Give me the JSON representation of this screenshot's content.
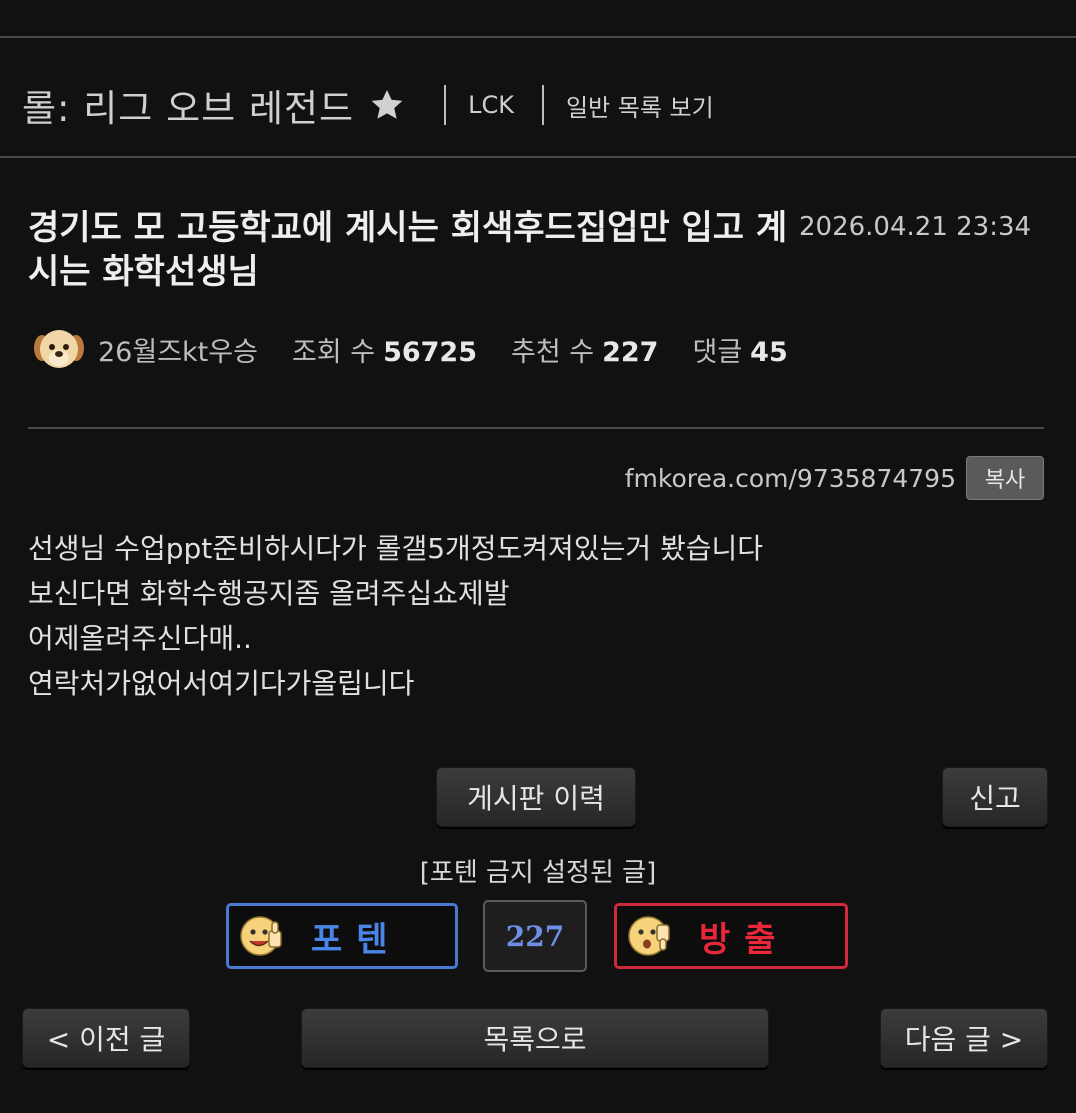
{
  "board": {
    "name": "롤: 리그 오브 레전드",
    "nav": [
      "LCK",
      "일반 목록 보기"
    ]
  },
  "post": {
    "title": "경기도 모 고등학교에 계시는 회색후드집업만 입고 계시는 화학선생님",
    "date": "2026.04.21 23:34",
    "author": "26월즈kt우승",
    "views_label": "조회 수",
    "views": "56725",
    "recommend_label": "추천 수",
    "recommend": "227",
    "comments_label": "댓글",
    "comments": "45",
    "url": "fmkorea.com/9735874795",
    "copy_label": "복사",
    "body": [
      "선생님 수업ppt준비하시다가 롤갤5개정도켜져있는거 봤습니다",
      "보신다면 화학수행공지좀 올려주십쇼제발",
      "어제올려주신다매..",
      "연락처가없어서여기다가올립니다"
    ]
  },
  "actions": {
    "history": "게시판 이력",
    "report": "신고",
    "notice": "[포텐 금지 설정된 글]",
    "upvote": "포텐",
    "vote_count": "227",
    "downvote": "방출",
    "prev": "< 이전 글",
    "list": "목록으로",
    "next": "다음 글 >"
  },
  "colors": {
    "background": "#111111",
    "upvote_border": "#4b78d1",
    "upvote_text": "#4a86e8",
    "downvote_border": "#d12b3b",
    "downvote_text": "#e8273a",
    "vote_count_text": "#6f8fe6"
  },
  "icons": {
    "favorite": "star-icon",
    "avatar": "puppy-avatar-icon",
    "upvote": "thumbs-up-face-icon",
    "downvote": "thumbs-down-face-icon"
  }
}
